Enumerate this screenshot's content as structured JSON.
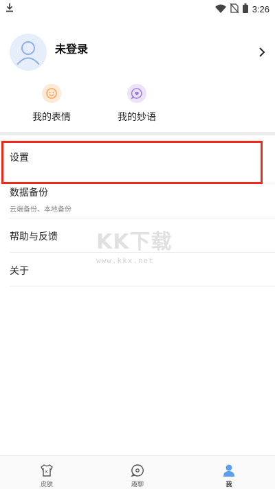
{
  "status_bar": {
    "time": "3:26",
    "icons": [
      "download-icon",
      "wifi-icon",
      "no-sim-icon",
      "battery-icon"
    ]
  },
  "profile": {
    "name": "未登录",
    "avatar_icon": "user-avatar-icon",
    "arrow_icon": "chevron-right-icon"
  },
  "shortcuts": [
    {
      "label": "我的表情",
      "icon": "smiley-icon",
      "color": "#f5a55a"
    },
    {
      "label": "我的妙语",
      "icon": "heart-chat-icon",
      "color": "#9b7bd8"
    }
  ],
  "menu": {
    "settings": {
      "title": "设置"
    },
    "backup": {
      "title": "数据备份",
      "subtitle": "云端备份、本地备份"
    },
    "help": {
      "title": "帮助与反馈"
    },
    "about": {
      "title": "关于"
    }
  },
  "watermark": {
    "logo": "KK下载",
    "url": "www.kkx.net"
  },
  "bottom_nav": [
    {
      "label": "皮肤",
      "icon": "shirt-icon",
      "active": false
    },
    {
      "label": "趣聊",
      "icon": "chat-bubble-icon",
      "active": false
    },
    {
      "label": "我",
      "icon": "person-icon",
      "active": true
    }
  ],
  "colors": {
    "highlight": "#ee2a1b",
    "accent": "#5b9ff0"
  }
}
